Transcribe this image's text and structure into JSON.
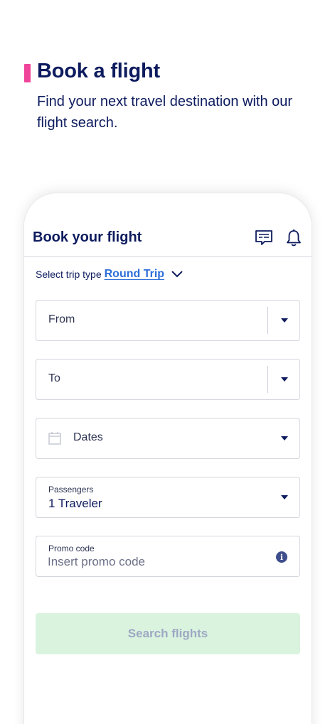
{
  "hero": {
    "title": "Book a flight",
    "subtitle": "Find your next travel destination with our flight search."
  },
  "app": {
    "header_title": "Book your flight",
    "icons": [
      "chat-icon",
      "bell-icon"
    ]
  },
  "trip": {
    "label": "Select trip type",
    "value": "Round Trip"
  },
  "fields": {
    "from_label": "From",
    "to_label": "To",
    "dates_label": "Dates",
    "passengers_label": "Passengers",
    "passengers_value": "1 Traveler",
    "promo_label": "Promo code",
    "promo_placeholder": "Insert promo code"
  },
  "search_button": "Search flights",
  "colors": {
    "brand_navy": "#0d1b5e",
    "accent_pink": "#f0449a",
    "link_blue": "#2e6fd9",
    "button_disabled_bg": "#d9f3df"
  }
}
